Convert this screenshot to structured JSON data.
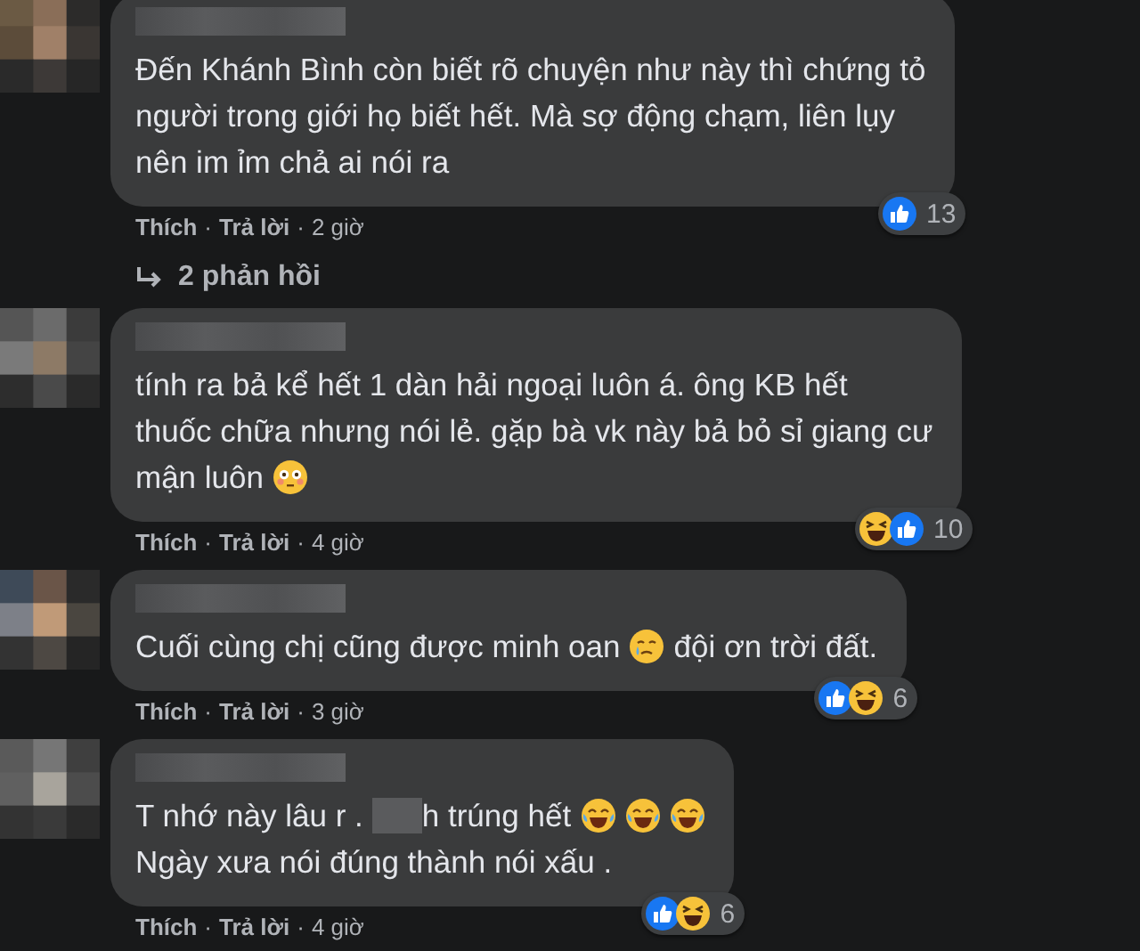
{
  "comments": [
    {
      "lines": [
        [
          {
            "kind": "text",
            "text": "Đến Khánh Bình còn biết rõ chuyện như này thì chứng tỏ"
          }
        ],
        [
          {
            "kind": "text",
            "text": "người trong giới họ biết hết. Mà sợ động chạm, liên lụy"
          }
        ],
        [
          {
            "kind": "text",
            "text": "nên im ỉm chả ai nói ra"
          }
        ]
      ],
      "reactions": [
        {
          "kind": "like"
        }
      ],
      "reaction_count": "13",
      "actions": [
        {
          "kind": "link",
          "text": "Thích"
        },
        {
          "kind": "dot",
          "text": "·"
        },
        {
          "kind": "link",
          "text": "Trả lời"
        },
        {
          "kind": "dot",
          "text": "·"
        },
        {
          "kind": "time",
          "text": "2 giờ"
        }
      ],
      "replies": "2 phản hồi"
    },
    {
      "lines": [
        [
          {
            "kind": "text",
            "text": "tính ra bả kể hết 1 dàn hải ngoại luôn á. ông KB hết"
          }
        ],
        [
          {
            "kind": "text",
            "text": "thuốc chữa nhưng nói lẻ. gặp bà vk này bả bỏ sỉ giang cư"
          }
        ],
        [
          {
            "kind": "text",
            "text": "mận luôn"
          },
          {
            "kind": "flushed"
          }
        ]
      ],
      "reactions": [
        {
          "kind": "haha"
        },
        {
          "kind": "like"
        }
      ],
      "reaction_count": "10",
      "actions": [
        {
          "kind": "link",
          "text": "Thích"
        },
        {
          "kind": "dot",
          "text": "·"
        },
        {
          "kind": "link",
          "text": "Trả lời"
        },
        {
          "kind": "dot",
          "text": "·"
        },
        {
          "kind": "time",
          "text": "4 giờ"
        }
      ]
    },
    {
      "lines": [
        [
          {
            "kind": "text",
            "text": "Cuối cùng chị cũng được minh oan"
          },
          {
            "kind": "tear"
          },
          {
            "kind": "text",
            "text": "đội ơn trời đất."
          }
        ]
      ],
      "reactions": [
        {
          "kind": "like"
        },
        {
          "kind": "haha"
        }
      ],
      "reaction_count": "6",
      "actions": [
        {
          "kind": "link",
          "text": "Thích"
        },
        {
          "kind": "dot",
          "text": "·"
        },
        {
          "kind": "link",
          "text": "Trả lời"
        },
        {
          "kind": "dot",
          "text": "·"
        },
        {
          "kind": "time",
          "text": "3 giờ"
        }
      ]
    },
    {
      "lines": [
        [
          {
            "kind": "text",
            "text": "T nhớ này lâu r ."
          },
          {
            "kind": "blur"
          },
          {
            "kind": "text",
            "text": "h trúng hết"
          },
          {
            "kind": "joy"
          },
          {
            "kind": "joy"
          },
          {
            "kind": "joy"
          }
        ],
        [
          {
            "kind": "text",
            "text": "Ngày xưa nói đúng thành nói xấu ."
          }
        ]
      ],
      "reactions": [
        {
          "kind": "like"
        },
        {
          "kind": "haha"
        }
      ],
      "reaction_count": "6",
      "actions": [
        {
          "kind": "link",
          "text": "Thích"
        },
        {
          "kind": "dot",
          "text": "·"
        },
        {
          "kind": "link",
          "text": "Trả lời"
        },
        {
          "kind": "dot",
          "text": "·"
        },
        {
          "kind": "time",
          "text": "4 giờ"
        }
      ]
    }
  ]
}
